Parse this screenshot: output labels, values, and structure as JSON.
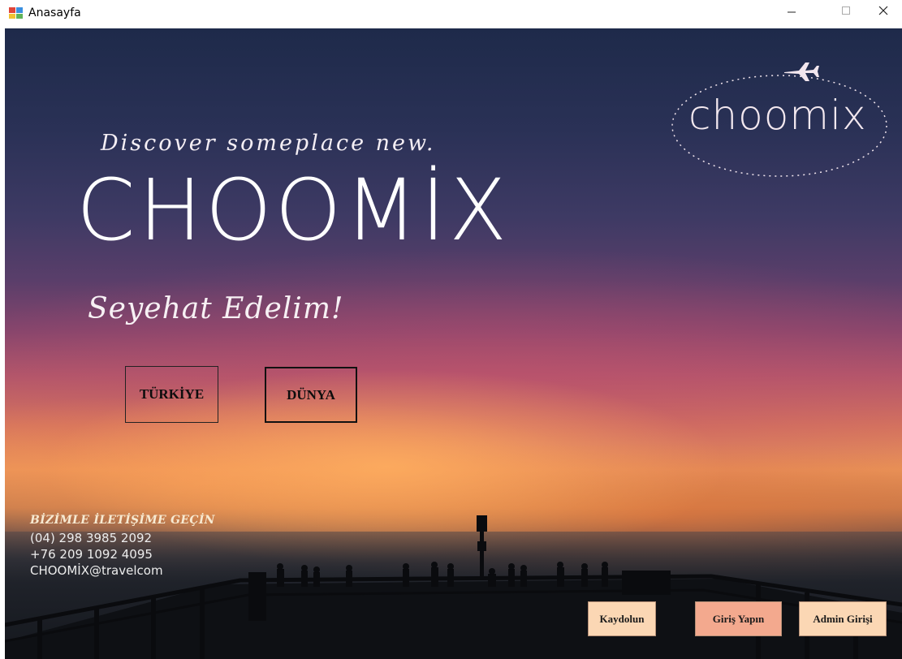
{
  "window": {
    "title": "Anasayfa"
  },
  "hero": {
    "tagline": "Discover someplace new.",
    "title": "CHOOMİX",
    "slogan": "Seyehat Edelim!"
  },
  "logo": {
    "text": "choomix"
  },
  "destinations": {
    "turkey_label": "TÜRKİYE",
    "world_label": "DÜNYA"
  },
  "contact": {
    "title": "BİZİMLE İLETİŞİME GEÇİN",
    "phone1": "(04) 298 3985 2092",
    "phone2": "+76 209 1092 4095",
    "email": "CHOOMİX@travelcom"
  },
  "actions": {
    "signup_label": "Kaydolun",
    "login_label": "Giriş Yapın",
    "admin_label": "Admin Girişi"
  },
  "colors": {
    "signup_bg": "#fbd7b4",
    "login_bg": "#f3a98e",
    "admin_bg": "#fbd7b4"
  },
  "icons": {
    "app": "winforms-app-icon",
    "minimize": "minimize-icon",
    "maximize": "maximize-icon",
    "close": "close-icon",
    "logo_plane": "airplane-icon"
  }
}
